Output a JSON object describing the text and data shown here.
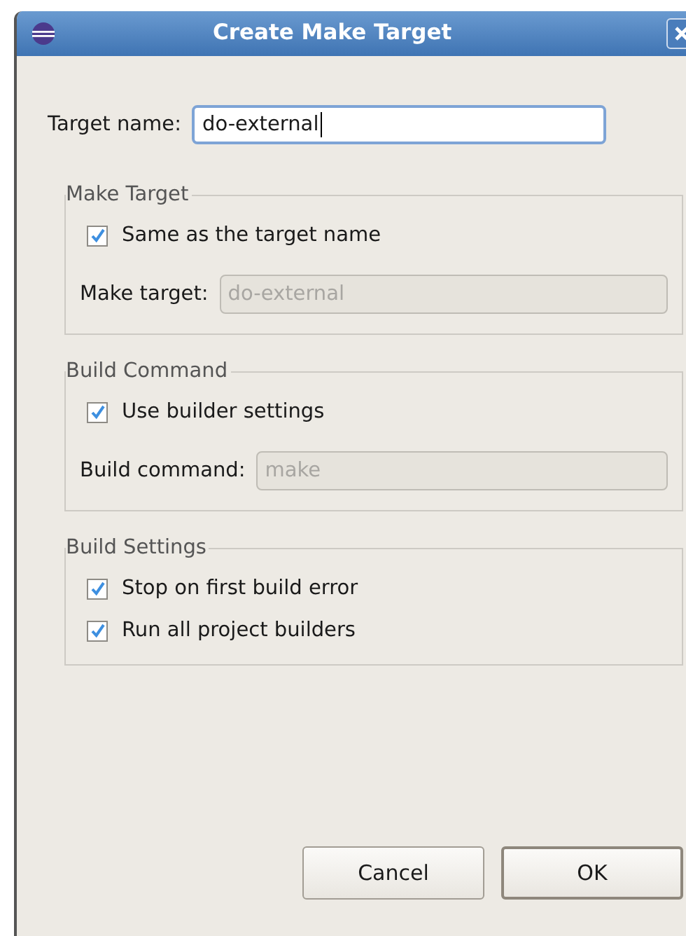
{
  "window": {
    "title": "Create Make Target"
  },
  "target_name": {
    "label": "Target name:",
    "value": "do-external"
  },
  "groups": [
    {
      "title": "Make Target",
      "items": [
        {
          "kind": "checkbox",
          "label": "Same as the target name",
          "checked": true
        },
        {
          "kind": "field",
          "label": "Make target:",
          "value": "do-external",
          "disabled": true
        }
      ]
    },
    {
      "title": "Build Command",
      "items": [
        {
          "kind": "checkbox",
          "label": "Use builder settings",
          "checked": true
        },
        {
          "kind": "field",
          "label": "Build command:",
          "value": "make",
          "disabled": true
        }
      ]
    },
    {
      "title": "Build Settings",
      "items": [
        {
          "kind": "checkbox",
          "label": "Stop on first build error",
          "checked": true
        },
        {
          "kind": "checkbox",
          "label": "Run all project builders",
          "checked": true
        }
      ]
    }
  ],
  "buttons": [
    {
      "label": "Cancel",
      "default": false
    },
    {
      "label": "OK",
      "default": true
    }
  ]
}
